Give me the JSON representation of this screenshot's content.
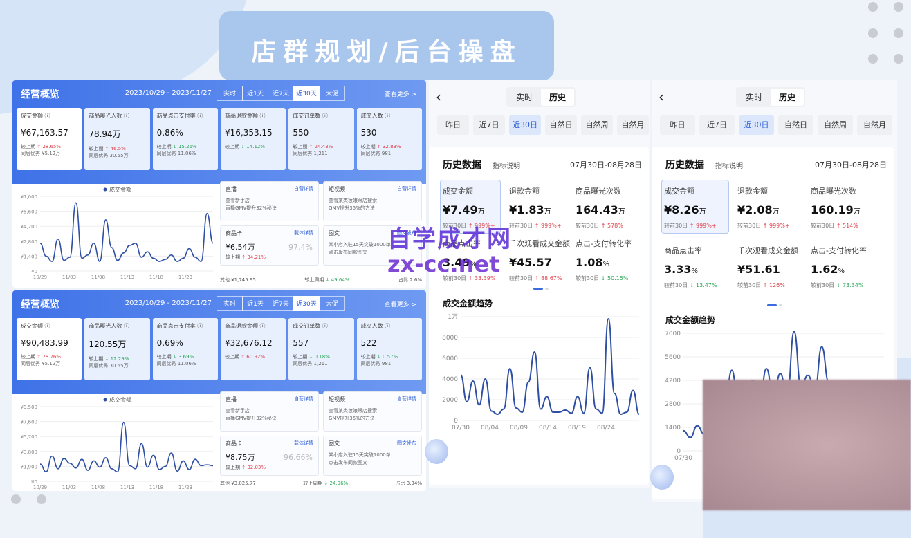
{
  "banner": {
    "title": "店群规划/后台操盘"
  },
  "dash1": {
    "title": "经营概览",
    "date": "2023/10/29 - 2023/11/27",
    "tabs": [
      "实时",
      "近1天",
      "近7天",
      "近30天",
      "大促"
    ],
    "active": 3,
    "more": "查看更多 >",
    "kpis": [
      {
        "label": "成交金额 ⓘ",
        "value": "¥67,163.57",
        "cmp": "较上期",
        "delta": "↑ 28.65%",
        "dir": "up",
        "peer": "同层优秀 ¥5.12万"
      },
      {
        "label": "商品曝光人数 ⓘ",
        "value": "78.94万",
        "cmp": "较上期",
        "delta": "↑ 46.5%",
        "dir": "up",
        "peer": "同层优秀 30.55万"
      },
      {
        "label": "商品点击支付率 ⓘ",
        "value": "0.86%",
        "cmp": "较上期",
        "delta": "↓ 15.26%",
        "dir": "dn",
        "peer": "同层优秀 11.06%"
      },
      {
        "label": "商品退款金额 ⓘ",
        "value": "¥16,353.15",
        "cmp": "较上期",
        "delta": "↓ 14.12%",
        "dir": "dn",
        "peer": ""
      },
      {
        "label": "成交订单数 ⓘ",
        "value": "550",
        "cmp": "较上期",
        "delta": "↑ 24.43%",
        "dir": "up",
        "peer": "同层优秀 1,211"
      },
      {
        "label": "成交人数 ⓘ",
        "value": "530",
        "cmp": "较上期",
        "delta": "↑ 32.83%",
        "dir": "up",
        "peer": "同层优秀 981"
      }
    ],
    "chart_data": {
      "type": "line",
      "title": "",
      "series": [
        {
          "name": "成交金额",
          "values": [
            2600,
            1400,
            900,
            3000,
            1000,
            1300,
            6400,
            1200,
            1500,
            2600,
            900,
            4800,
            2200,
            1000,
            1700,
            2400,
            2600,
            1300,
            1800,
            1200,
            900,
            1100,
            1500,
            900,
            1200,
            2100,
            1300,
            900,
            5400,
            2600
          ]
        }
      ],
      "xticks": [
        "10/29",
        "11/03",
        "11/08",
        "11/13",
        "11/18",
        "11/23"
      ],
      "yticks": [
        "¥7,000",
        "¥5,600",
        "¥4,200",
        "¥2,800",
        "¥1,400",
        "¥0"
      ],
      "ylim": [
        0,
        7000
      ]
    },
    "cards": [
      {
        "title": "直播",
        "link": "自营详情",
        "desc1": "查看新手店",
        "desc2": "直播GMV提升32%秘诀"
      },
      {
        "title": "短视频",
        "link": "自营详情",
        "desc1": "查看某类妆娘眼店搜索",
        "desc2": "GMV提升35%的方法"
      },
      {
        "title": "商品卡",
        "link": "载体详情",
        "value": "¥6.54万",
        "pct": "97.4%",
        "cmp": "较上期",
        "delta": "↑ 34.21%"
      },
      {
        "title": "图文",
        "link": "图文发布",
        "desc1": "某小店入驻15天突破1000单",
        "desc2": "点击发布同款图文"
      }
    ],
    "footer": {
      "other": "其他 ¥1,745.95",
      "cmp": "较上周期",
      "delta": "↓ 49.64%",
      "share": "占比 2.6%"
    }
  },
  "dash2": {
    "title": "经营概览",
    "date": "2023/10/29 - 2023/11/27",
    "tabs": [
      "实时",
      "近1天",
      "近7天",
      "近30天",
      "大促"
    ],
    "active": 3,
    "more": "查看更多 >",
    "kpis": [
      {
        "label": "成交金额 ⓘ",
        "value": "¥90,483.99",
        "cmp": "较上期",
        "delta": "↑ 28.76%",
        "dir": "up",
        "peer": "同层优秀 ¥5.12万"
      },
      {
        "label": "商品曝光人数 ⓘ",
        "value": "120.55万",
        "cmp": "较上期",
        "delta": "↓ 12.29%",
        "dir": "dn",
        "peer": "同层优秀 30.55万"
      },
      {
        "label": "商品点击支付率 ⓘ",
        "value": "0.69%",
        "cmp": "较上期",
        "delta": "↓ 3.69%",
        "dir": "dn",
        "peer": "同层优秀 11.06%"
      },
      {
        "label": "商品退款金额 ⓘ",
        "value": "¥32,676.12",
        "cmp": "较上期",
        "delta": "↑ 60.92%",
        "dir": "up",
        "peer": ""
      },
      {
        "label": "成交订单数 ⓘ",
        "value": "557",
        "cmp": "较上期",
        "delta": "↓ 0.18%",
        "dir": "dn",
        "peer": "同层优秀 1,211"
      },
      {
        "label": "成交人数 ⓘ",
        "value": "522",
        "cmp": "较上期",
        "delta": "↓ 0.57%",
        "dir": "dn",
        "peer": "同层优秀 981"
      }
    ],
    "chart_data": {
      "type": "line",
      "title": "",
      "series": [
        {
          "name": "成交金额",
          "values": [
            2200,
            1200,
            3200,
            1600,
            2900,
            2300,
            1700,
            2800,
            1400,
            2600,
            1800,
            3000,
            1600,
            1200,
            7500,
            2000,
            1600,
            4800,
            1800,
            3300,
            1500,
            1900,
            3600,
            1300,
            2600,
            1500,
            2800,
            2000,
            2100,
            2000
          ]
        }
      ],
      "xticks": [
        "10/29",
        "11/03",
        "11/08",
        "11/13",
        "11/18",
        "11/23"
      ],
      "yticks": [
        "¥9,500",
        "¥7,600",
        "¥5,700",
        "¥3,800",
        "¥1,900",
        "¥0"
      ],
      "ylim": [
        0,
        9500
      ]
    },
    "cards": [
      {
        "title": "直播",
        "link": "自营详情",
        "desc1": "查看新手店",
        "desc2": "直播GMV提升32%秘诀"
      },
      {
        "title": "短视频",
        "link": "自营详情",
        "desc1": "查看某类妆娘眼店搜索",
        "desc2": "GMV提升35%的方法"
      },
      {
        "title": "商品卡",
        "link": "载体详情",
        "value": "¥8.75万",
        "pct": "96.66%",
        "cmp": "较上期",
        "delta": "↑ 32.03%"
      },
      {
        "title": "图文",
        "link": "图文发布",
        "desc1": "某小店入驻15天突破1000单",
        "desc2": "点击发布同款图文"
      }
    ],
    "footer": {
      "other": "其他 ¥3,025.77",
      "cmp": "较上周期",
      "delta": "↓ 24.96%",
      "share": "占比 3.34%"
    }
  },
  "mob1": {
    "seg": [
      "实时",
      "历史"
    ],
    "chips": [
      "昨日",
      "近7日",
      "近30日",
      "自然日",
      "自然周",
      "自然月"
    ],
    "title": "历史数据",
    "sub": "指标说明",
    "range": "07月30日-08月28日",
    "metrics": [
      {
        "label": "成交金额",
        "value": "¥7.49",
        "unit": "万",
        "cmp": "较前30日",
        "delta": "↑ 999%+",
        "dir": "up"
      },
      {
        "label": "退款金额",
        "value": "¥1.83",
        "unit": "万",
        "cmp": "较前30日",
        "delta": "↑ 999%+",
        "dir": "up"
      },
      {
        "label": "商品曝光次数",
        "value": "164.43",
        "unit": "万",
        "cmp": "较前30日",
        "delta": "↑ 578%",
        "dir": "up"
      },
      {
        "label": "商品点击率",
        "value": "3.49",
        "unit": "%",
        "cmp": "较前30日",
        "delta": "↑ 33.39%",
        "dir": "up"
      },
      {
        "label": "千次观看成交金额",
        "value": "¥45.57",
        "unit": "",
        "cmp": "较前30日",
        "delta": "↑ 88.67%",
        "dir": "up"
      },
      {
        "label": "点击-支付转化率",
        "value": "1.08",
        "unit": "%",
        "cmp": "较前30日",
        "delta": "↓ 50.15%",
        "dir": "dn"
      }
    ],
    "trend": "成交金额趋势",
    "chart_data": {
      "type": "line",
      "series": [
        {
          "values": [
            4400,
            1800,
            3800,
            1500,
            4000,
            900,
            600,
            1100,
            5000,
            1200,
            800,
            3700,
            6600,
            1100,
            2300,
            800,
            800,
            1000,
            700,
            2300,
            700,
            5100,
            1100,
            700,
            9800,
            2600,
            600,
            800,
            2900,
            600
          ]
        }
      ],
      "xticks": [
        "07/30",
        "08/04",
        "08/09",
        "08/14",
        "08/19",
        "08/24"
      ],
      "yticks": [
        "1万",
        "8000",
        "6000",
        "4000",
        "2000",
        "0"
      ],
      "ylim": [
        0,
        10000
      ]
    }
  },
  "mob2": {
    "seg": [
      "实时",
      "历史"
    ],
    "chips": [
      "昨日",
      "近7日",
      "近30日",
      "自然日",
      "自然周",
      "自然月"
    ],
    "title": "历史数据",
    "sub": "指标说明",
    "range": "07月30日-08月28日",
    "metrics": [
      {
        "label": "成交金额",
        "value": "¥8.26",
        "unit": "万",
        "cmp": "较前30日",
        "delta": "↑ 999%+",
        "dir": "up"
      },
      {
        "label": "退款金额",
        "value": "¥2.08",
        "unit": "万",
        "cmp": "较前30日",
        "delta": "↑ 999%+",
        "dir": "up"
      },
      {
        "label": "商品曝光次数",
        "value": "160.19",
        "unit": "万",
        "cmp": "较前30日",
        "delta": "↑ 514%",
        "dir": "up"
      },
      {
        "label": "商品点击率",
        "value": "3.33",
        "unit": "%",
        "cmp": "较前30日",
        "delta": "↓ 13.47%",
        "dir": "dn"
      },
      {
        "label": "千次观看成交金额",
        "value": "¥51.61",
        "unit": "",
        "cmp": "较前30日",
        "delta": "↑ 126%",
        "dir": "up"
      },
      {
        "label": "点击-支付转化率",
        "value": "1.62",
        "unit": "%",
        "cmp": "较前30日",
        "delta": "↓ 73.34%",
        "dir": "dn"
      }
    ],
    "trend": "成交金额趋势",
    "chart_data": {
      "type": "line",
      "series": [
        {
          "values": [
            1200,
            800,
            1500,
            1000,
            2600,
            3500,
            2800,
            4800,
            2400,
            3600,
            4200,
            2900,
            4900,
            3200,
            4600,
            3300,
            7100,
            3800,
            4500,
            3600,
            6200,
            4100
          ]
        }
      ],
      "xticks": [
        "07/30"
      ],
      "yticks": [
        "7000",
        "5600",
        "4200",
        "2800",
        "1400",
        "0"
      ],
      "ylim": [
        0,
        7000
      ]
    }
  },
  "watermark": {
    "line1": "自学成才网",
    "line2": "zx-cc.net"
  }
}
